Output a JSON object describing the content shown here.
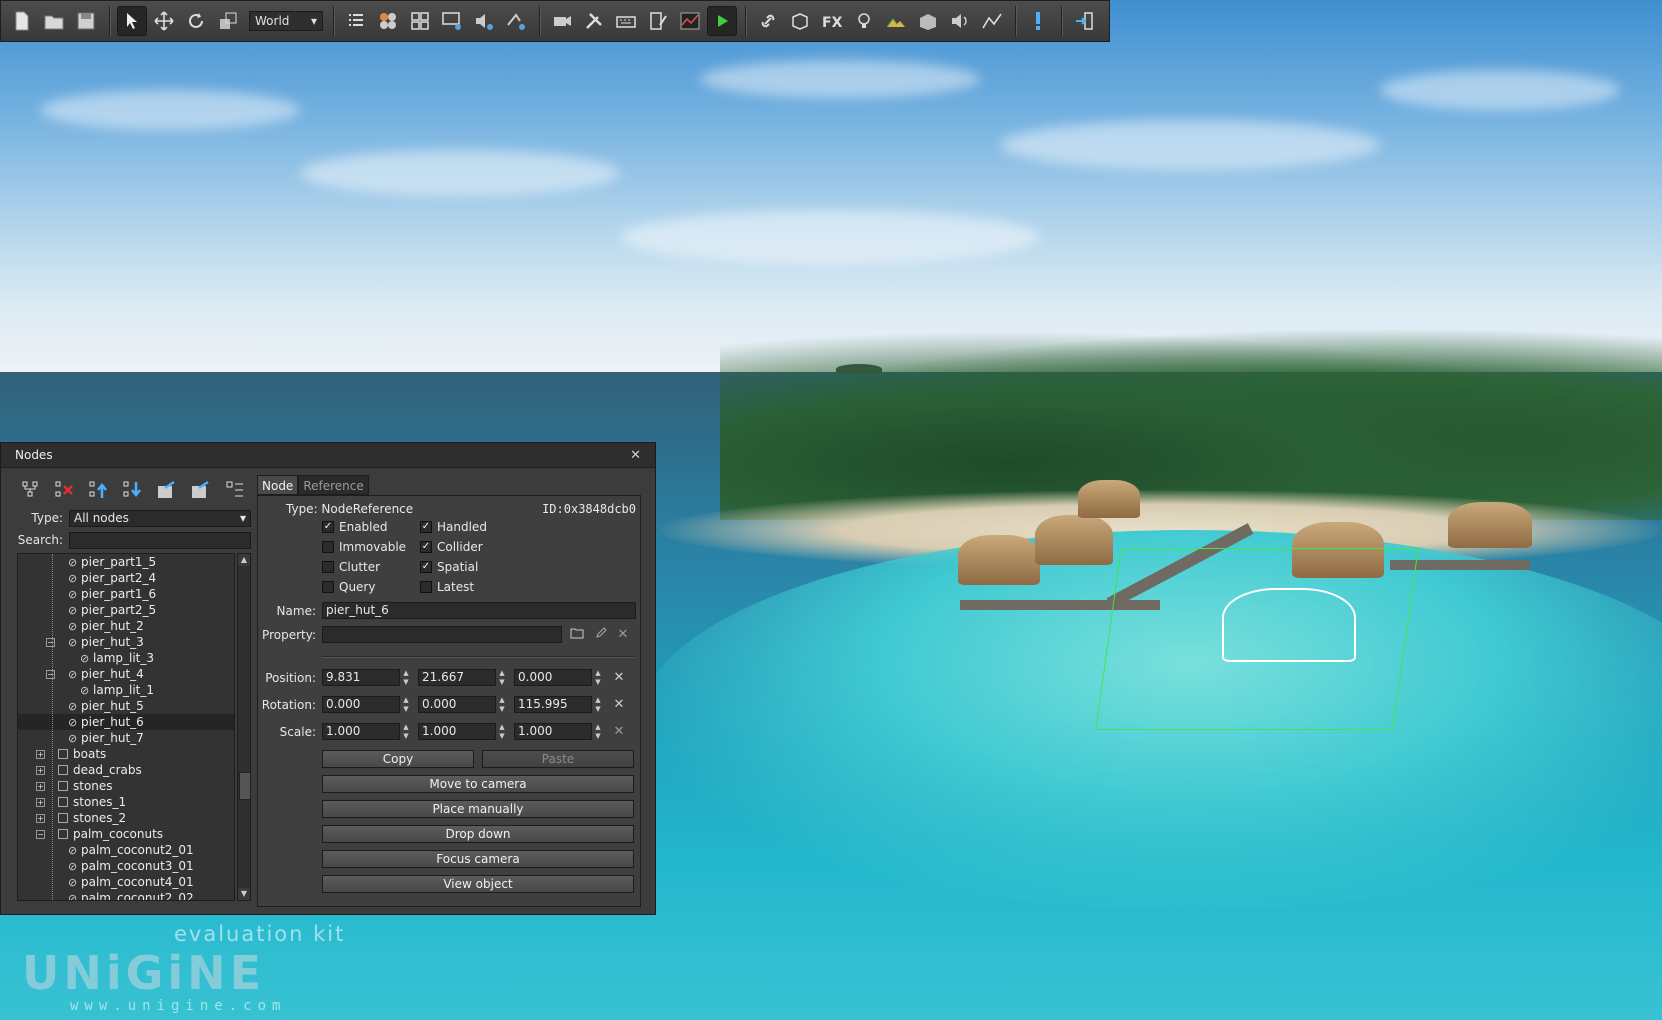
{
  "toolbar": {
    "buttons": [
      {
        "icon": "new-file-icon"
      },
      {
        "icon": "open-folder-icon"
      },
      {
        "icon": "save-icon"
      },
      {
        "icon": "select-arrow-icon"
      },
      {
        "icon": "move-icon"
      },
      {
        "icon": "rotate-icon"
      },
      {
        "icon": "scale-icon"
      },
      {
        "icon": "node-list-icon"
      },
      {
        "icon": "materials-icon"
      },
      {
        "icon": "properties-grid-icon"
      },
      {
        "icon": "render-settings-icon"
      },
      {
        "icon": "sound-settings-icon"
      },
      {
        "icon": "physics-settings-icon"
      },
      {
        "icon": "camera-icon"
      },
      {
        "icon": "tools-icon"
      },
      {
        "icon": "keyboard-icon"
      },
      {
        "icon": "script-editor-icon"
      },
      {
        "icon": "profiler-icon"
      },
      {
        "icon": "play-icon"
      },
      {
        "icon": "link-icon"
      },
      {
        "icon": "box-object-icon"
      },
      {
        "icon": "fx-icon"
      },
      {
        "icon": "light-bulb-icon"
      },
      {
        "icon": "terrain-icon"
      },
      {
        "icon": "world-object-icon"
      },
      {
        "icon": "speaker-icon"
      },
      {
        "icon": "path-icon"
      },
      {
        "icon": "warning-icon"
      },
      {
        "icon": "exit-icon"
      }
    ],
    "coord_system": "World"
  },
  "nodes_panel": {
    "title": "Nodes",
    "type_label": "Type:",
    "type_value": "All nodes",
    "search_label": "Search:",
    "search_value": "",
    "tree": [
      {
        "label": "pier_part1_5",
        "level": 2,
        "kind": "reference"
      },
      {
        "label": "pier_part2_4",
        "level": 2,
        "kind": "reference"
      },
      {
        "label": "pier_part1_6",
        "level": 2,
        "kind": "reference"
      },
      {
        "label": "pier_part2_5",
        "level": 2,
        "kind": "reference"
      },
      {
        "label": "pier_hut_2",
        "level": 2,
        "kind": "reference"
      },
      {
        "label": "pier_hut_3",
        "level": 2,
        "kind": "reference",
        "expanded": true
      },
      {
        "label": "lamp_lit_3",
        "level": 3,
        "kind": "reference"
      },
      {
        "label": "pier_hut_4",
        "level": 2,
        "kind": "reference",
        "expanded": true
      },
      {
        "label": "lamp_lit_1",
        "level": 3,
        "kind": "reference"
      },
      {
        "label": "pier_hut_5",
        "level": 2,
        "kind": "reference"
      },
      {
        "label": "pier_hut_6",
        "level": 2,
        "kind": "reference",
        "selected": true
      },
      {
        "label": "pier_hut_7",
        "level": 2,
        "kind": "reference"
      },
      {
        "label": "boats",
        "level": 1,
        "kind": "dummy",
        "collapsed": true
      },
      {
        "label": "dead_crabs",
        "level": 1,
        "kind": "dummy",
        "collapsed": true
      },
      {
        "label": "stones",
        "level": 1,
        "kind": "dummy",
        "collapsed": true
      },
      {
        "label": "stones_1",
        "level": 1,
        "kind": "dummy",
        "collapsed": true
      },
      {
        "label": "stones_2",
        "level": 1,
        "kind": "dummy",
        "collapsed": true
      },
      {
        "label": "palm_coconuts",
        "level": 1,
        "kind": "dummy",
        "expanded": true
      },
      {
        "label": "palm_coconut2_01",
        "level": 2,
        "kind": "reference"
      },
      {
        "label": "palm_coconut3_01",
        "level": 2,
        "kind": "reference"
      },
      {
        "label": "palm_coconut4_01",
        "level": 2,
        "kind": "reference"
      },
      {
        "label": "palm_coconut2_02",
        "level": 2,
        "kind": "reference"
      }
    ],
    "tabs": [
      "Node",
      "Reference"
    ],
    "type_line": "Type: NodeReference",
    "id_text": "ID:0x3848dcb0",
    "checkboxes": [
      {
        "label": "Enabled",
        "checked": true
      },
      {
        "label": "Handled",
        "checked": true
      },
      {
        "label": "Immovable",
        "checked": false
      },
      {
        "label": "Collider",
        "checked": true
      },
      {
        "label": "Clutter",
        "checked": false
      },
      {
        "label": "Spatial",
        "checked": true
      },
      {
        "label": "Query",
        "checked": false
      },
      {
        "label": "Latest",
        "checked": false
      }
    ],
    "name_label": "Name:",
    "name_value": "pier_hut_6",
    "property_label": "Property:",
    "property_value": "",
    "position_label": "Position:",
    "position": [
      "9.831",
      "21.667",
      "0.000"
    ],
    "rotation_label": "Rotation:",
    "rotation": [
      "0.000",
      "0.000",
      "115.995"
    ],
    "scale_label": "Scale:",
    "scale": [
      "1.000",
      "1.000",
      "1.000"
    ],
    "copy_label": "Copy",
    "paste_label": "Paste",
    "actions": [
      "Move to camera",
      "Place manually",
      "Drop down",
      "Focus camera",
      "View object"
    ]
  },
  "watermark": {
    "top": "evaluation kit",
    "logo": "UNiGiNE",
    "url": "www.unigine.com"
  },
  "colors": {
    "selection_box": "#3ee84a",
    "panel_bg": "#3c3c3c"
  }
}
